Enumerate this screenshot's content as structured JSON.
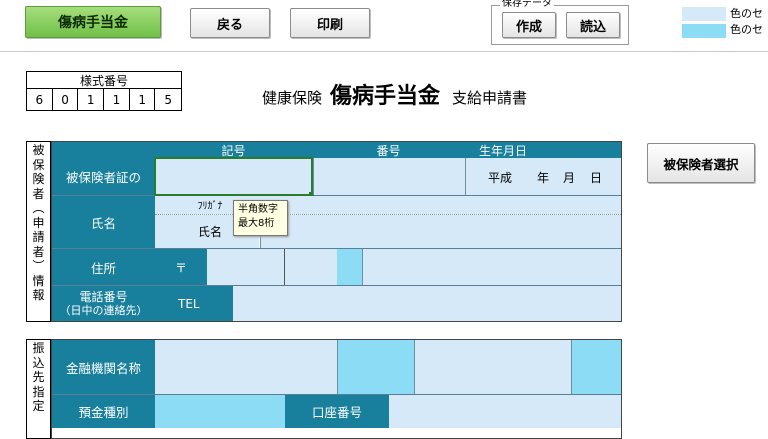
{
  "toolbar": {
    "title_button": "傷病手当金",
    "back_button": "戻る",
    "print_button": "印刷",
    "save_group_label": "保存データ",
    "create_button": "作成",
    "load_button": "読込"
  },
  "legend": {
    "item1_label": "色のセ",
    "item2_label": "色のセ",
    "item1_color": "#d6e9f8",
    "item2_color": "#8ddcf5"
  },
  "form_number": {
    "label": "様式番号",
    "digits": [
      "6",
      "0",
      "1",
      "1",
      "1",
      "5"
    ]
  },
  "form_title": {
    "prefix": "健康保険",
    "main": "傷病手当金",
    "suffix": "支給申請書"
  },
  "insured_section": {
    "vertical_label": [
      "被",
      "保",
      "険",
      "者",
      "︵",
      "申",
      "請",
      "者",
      "︶",
      "情",
      "報"
    ],
    "header_kigo": "記号",
    "header_bango": "番号",
    "header_birth": "生年月日",
    "card_label": "被保険者証の",
    "birth_era": "平成",
    "birth_year": "年",
    "birth_month": "月",
    "birth_day": "日",
    "furigana_label": "ﾌﾘｶﾞﾅ",
    "name_label": "氏名",
    "name_sub_label": "氏名",
    "address_label": "住所",
    "postal_mark": "〒",
    "phone_label": "電話番号",
    "phone_sub_label": "（日中の連絡先）",
    "tel_label": "TEL",
    "select_button": "被保険者選択"
  },
  "tooltip": {
    "line1": "半角数字",
    "line2": "最大8桁"
  },
  "bank_section": {
    "vertical_label": [
      "振",
      "込",
      "先",
      "指",
      "定"
    ],
    "bank_name_label": "金融機関名称",
    "deposit_type_label": "預金種別",
    "account_number_label": "口座番号"
  },
  "colors": {
    "accent_teal": "#187f9c",
    "field_pale": "#d6e9f8",
    "field_cyan": "#8ddcf5",
    "primary_green": "#71bf49"
  }
}
